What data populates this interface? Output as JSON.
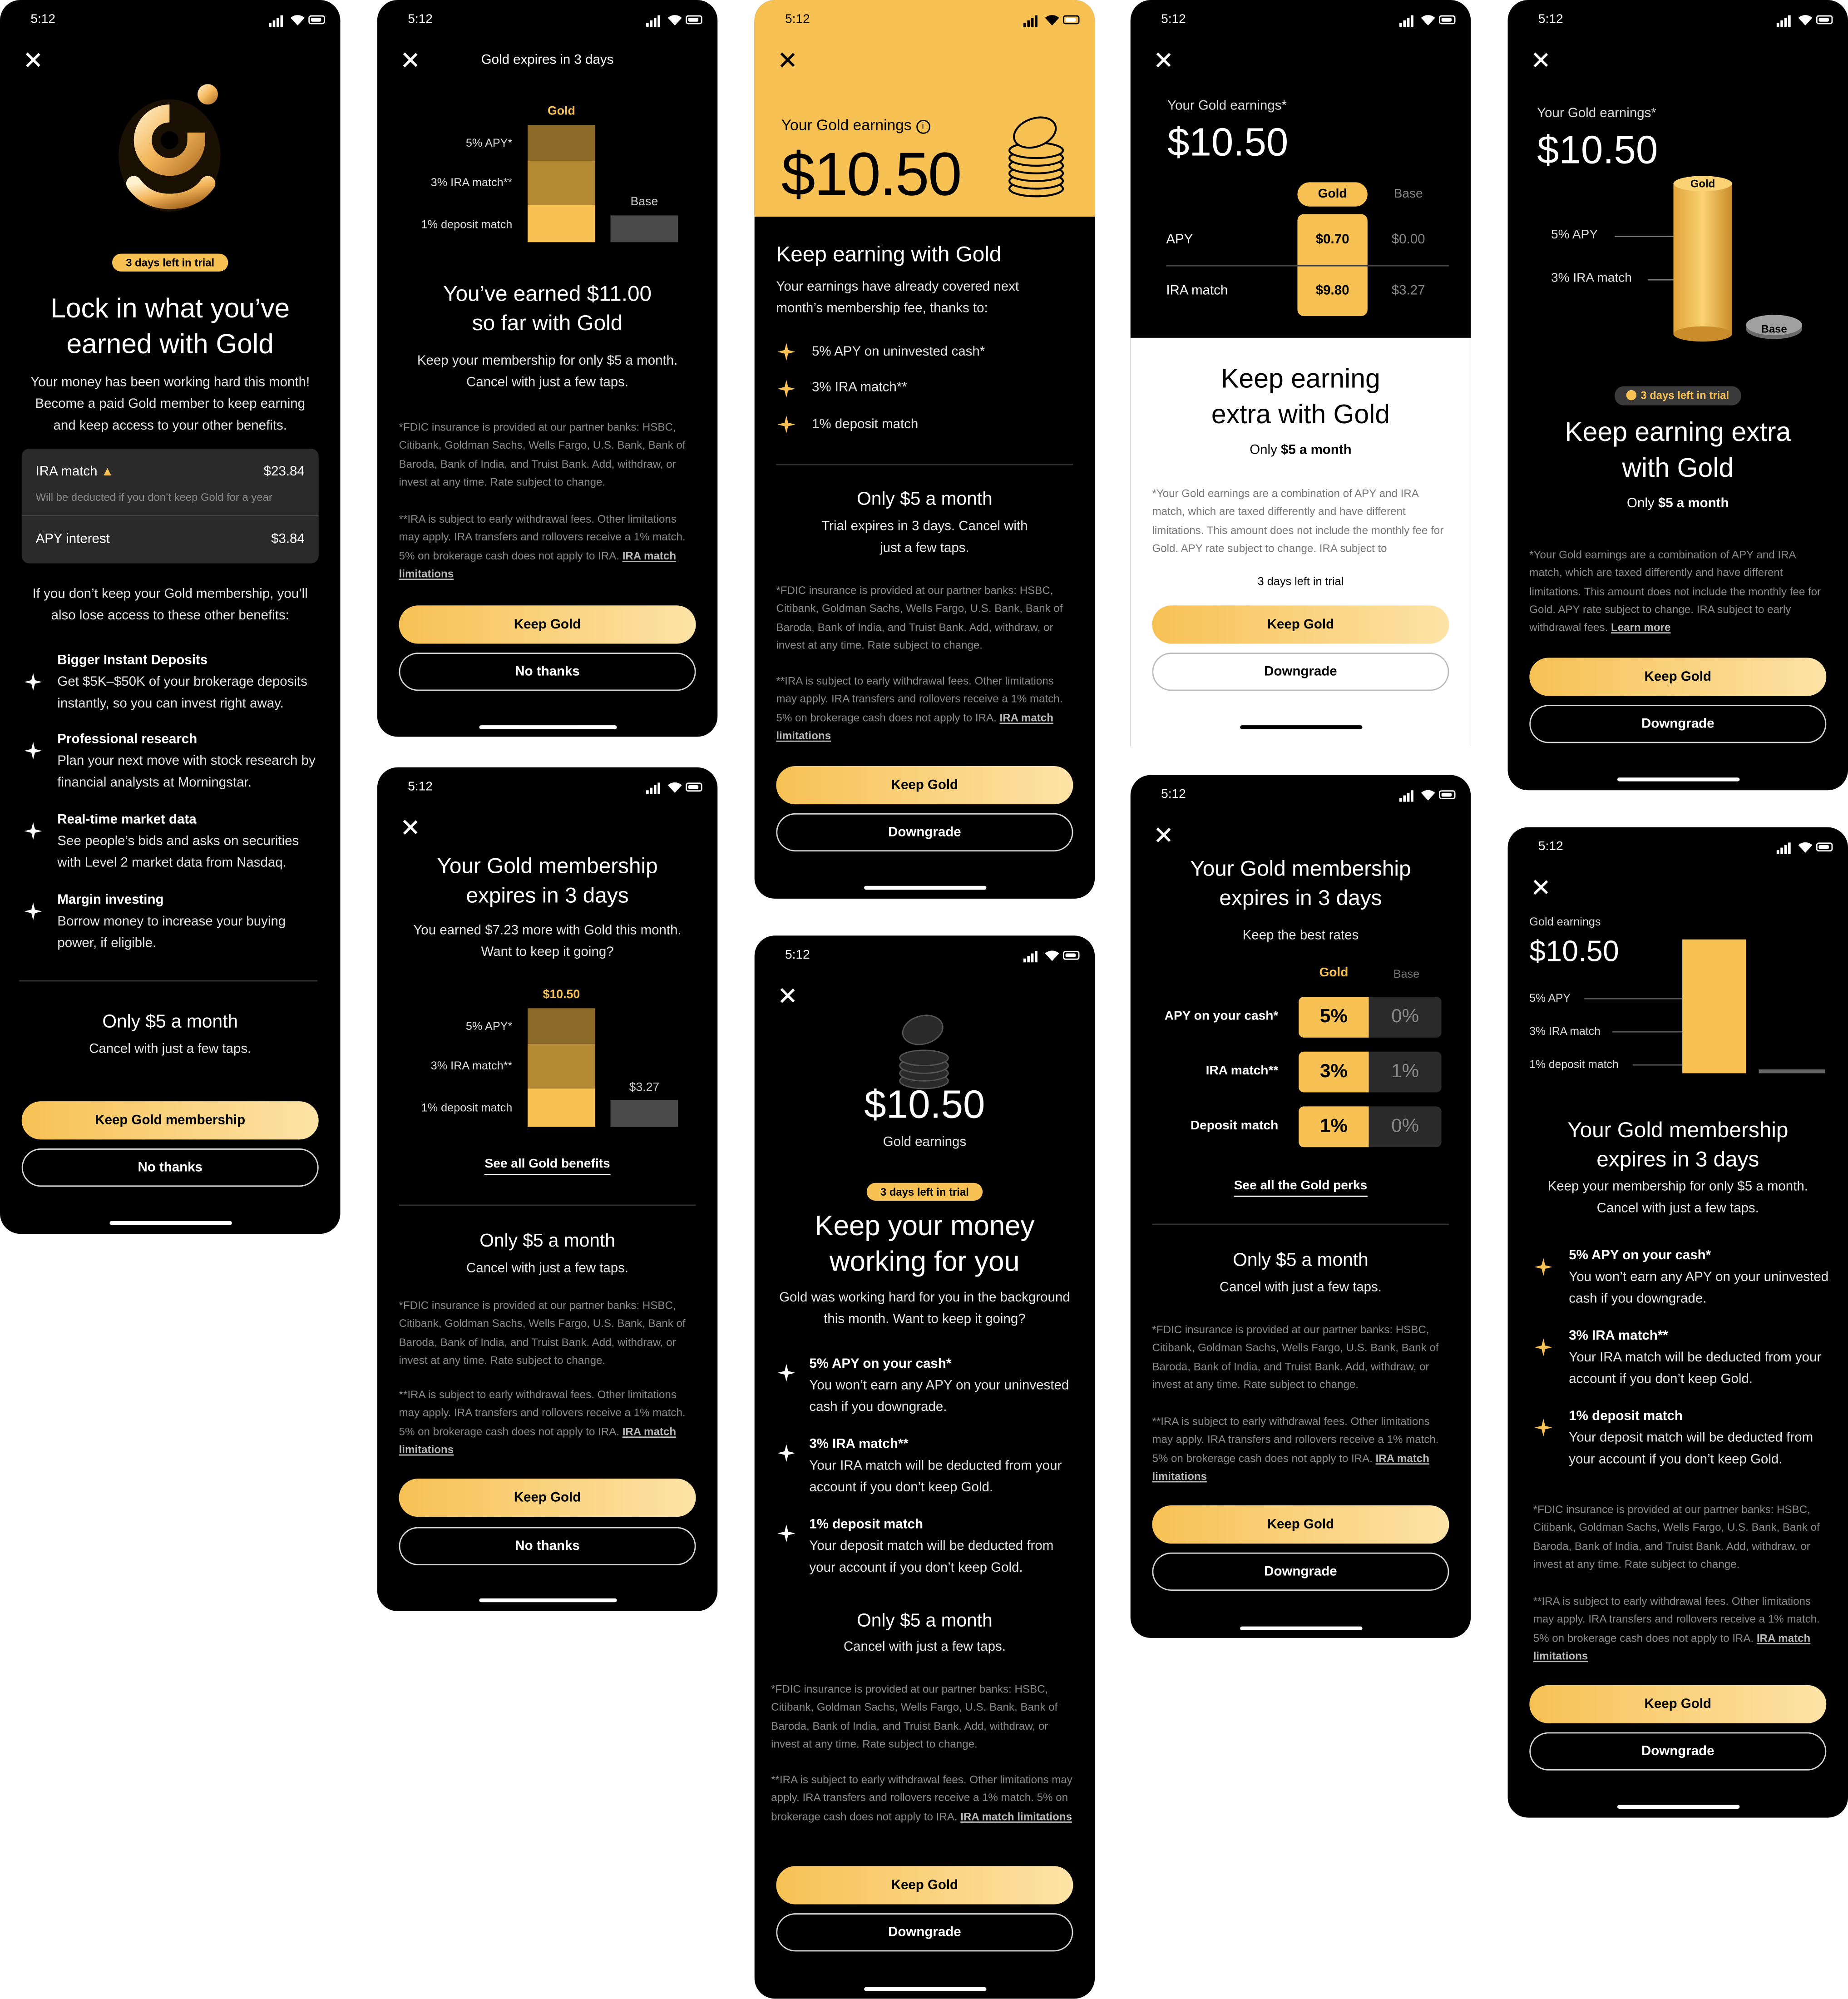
{
  "status": {
    "time": "5:12"
  },
  "s1": {
    "trial_pill": "3 days left in trial",
    "title": "Lock in what you’ve earned with Gold",
    "subtitle": "Your money has been working hard this month! Become a paid Gold member to keep earning and keep access to your other benefits.",
    "ira_label": "IRA match",
    "ira_value": "$23.84",
    "ira_note": "Will be deducted if you don’t keep Gold for a year",
    "apy_label": "APY interest",
    "apy_value": "$3.84",
    "lose_text": "If you don’t keep your Gold membership, you’ll also lose access to these other benefits:",
    "benefits": [
      {
        "title": "Bigger Instant Deposits",
        "desc": "Get $5K–$50K of your brokerage deposits instantly, so you can invest right away."
      },
      {
        "title": "Professional research",
        "desc": "Plan your next move with stock research by financial analysts at Morningstar."
      },
      {
        "title": "Real-time market data",
        "desc": "See people’s bids and asks on securities with Level 2 market data from Nasdaq."
      },
      {
        "title": "Margin investing",
        "desc": "Borrow money to increase your buying power, if eligible."
      }
    ],
    "price": "Only $5 a month",
    "price_sub": "Cancel with just a few taps.",
    "primary": "Keep Gold membership",
    "secondary": "No thanks"
  },
  "s2": {
    "header": "Gold expires in 3 days",
    "chart_gold_label": "Gold",
    "chart_base_label": "Base",
    "chart_rows": [
      "5% APY*",
      "3% IRA match**",
      "1% deposit match"
    ],
    "title": "You’ve earned $11.00 so far with Gold",
    "subtitle": "Keep your membership for only $5 a month. Cancel with just a few taps.",
    "fdic": "*FDIC insurance is provided at our partner banks: HSBC, Citibank, Goldman Sachs, Wells Fargo, U.S. Bank, Bank of Baroda, Bank of India, and Truist Bank. Add, withdraw, or invest at any time. Rate subject to change.",
    "ira_note": "**IRA is subject to early withdrawal fees. Other limitations may apply. IRA transfers and rollovers receive a 1% match. 5% on brokerage cash does not apply to IRA.",
    "ira_link": "IRA match limitations",
    "primary": "Keep Gold",
    "secondary": "No thanks"
  },
  "s3": {
    "title": "Your Gold membership expires in 3 days",
    "subtitle": "You earned $7.23 more with Gold this month. Want to keep it going?",
    "gold_total": "$10.50",
    "base_total": "$3.27",
    "chart_rows": [
      "5% APY*",
      "3% IRA match**",
      "1% deposit match"
    ],
    "link": "See all Gold benefits",
    "price": "Only $5 a month",
    "price_sub": "Cancel with just a few taps.",
    "fdic": "*FDIC insurance is provided at our partner banks: HSBC, Citibank, Goldman Sachs, Wells Fargo, U.S. Bank, Bank of Baroda, Bank of India, and Truist Bank. Add, withdraw, or invest at any time. Rate subject to change.",
    "ira_note": "**IRA is subject to early withdrawal fees. Other limitations may apply. IRA transfers and rollovers receive a 1% match. 5% on brokerage cash does not apply to IRA.",
    "ira_link": "IRA match limitations",
    "primary": "Keep Gold",
    "secondary": "No thanks"
  },
  "s4": {
    "earnings_label": "Your Gold earnings",
    "earnings_value": "$10.50",
    "title": "Keep earning with Gold",
    "subtitle": "Your earnings have already covered next month’s membership fee, thanks to:",
    "bullets": [
      "5% APY on uninvested cash*",
      "3% IRA match**",
      "1% deposit match"
    ],
    "price": "Only $5 a month",
    "price_sub": "Trial expires in 3 days. Cancel with just a few taps.",
    "fdic": "*FDIC insurance is provided at our partner banks: HSBC, Citibank, Goldman Sachs, Wells Fargo, U.S. Bank, Bank of Baroda, Bank of India, and Truist Bank. Add, withdraw, or invest at any time. Rate subject to change.",
    "ira_note": "**IRA is subject to early withdrawal fees. Other limitations may apply. IRA transfers and rollovers receive a 1% match. 5% on brokerage cash does not apply to IRA.",
    "ira_link": "IRA match limitations",
    "primary": "Keep Gold",
    "secondary": "Downgrade"
  },
  "s5": {
    "amount": "$10.50",
    "amount_label": "Gold earnings",
    "trial_pill": "3 days left in trial",
    "title": "Keep your money working for you",
    "subtitle": "Gold was working hard for you in the background this month. Want to keep it going?",
    "benefits": [
      {
        "title": "5% APY on your cash*",
        "desc": "You won’t earn any APY on your uninvested cash if you downgrade."
      },
      {
        "title": "3% IRA match**",
        "desc": "Your IRA match will be deducted from your account if you don’t keep Gold."
      },
      {
        "title": "1% deposit match",
        "desc": "Your deposit match will be deducted from your account if you don’t keep Gold."
      }
    ],
    "price": "Only $5 a month",
    "price_sub": "Cancel with just a few taps.",
    "fdic": "*FDIC insurance is provided at our partner banks: HSBC, Citibank, Goldman Sachs, Wells Fargo, U.S. Bank, Bank of Baroda, Bank of India, and Truist Bank. Add, withdraw, or invest at any time. Rate subject to change.",
    "ira_note": "**IRA is subject to early withdrawal fees. Other limitations may apply. IRA transfers and rollovers receive a 1% match. 5% on brokerage cash does not apply to IRA.",
    "ira_link": "IRA match limitations",
    "primary": "Keep Gold",
    "secondary": "Downgrade"
  },
  "s6": {
    "earnings_label": "Your Gold earnings*",
    "earnings_value": "$10.50",
    "col_gold": "Gold",
    "col_base": "Base",
    "rows": [
      {
        "label": "APY",
        "gold": "$0.70",
        "base": "$0.00"
      },
      {
        "label": "IRA match",
        "gold": "$9.80",
        "base": "$3.27"
      }
    ],
    "title": "Keep earning extra with Gold",
    "subtitle_pre": "Only",
    "subtitle_bold": "$5 a month",
    "note": "*Your Gold earnings are a combination of APY and IRA match, which are taxed differently and have different limitations. This amount does not include the monthly fee for Gold. APY rate subject to change. IRA subject to",
    "trial": "3 days left in trial",
    "primary": "Keep Gold",
    "secondary": "Downgrade"
  },
  "s7": {
    "title": "Your Gold membership expires in 3 days",
    "subtitle": "Keep the best rates",
    "col_gold": "Gold",
    "col_base": "Base",
    "rows": [
      {
        "label": "APY  on your cash*",
        "gold": "5%",
        "base": "0%"
      },
      {
        "label": "IRA match**",
        "gold": "3%",
        "base": "1%"
      },
      {
        "label": "Deposit match",
        "gold": "1%",
        "base": "0%"
      }
    ],
    "link": "See all the Gold perks",
    "price": "Only $5 a month",
    "price_sub": "Cancel with just a few taps.",
    "fdic": "*FDIC insurance is provided at our partner banks: HSBC, Citibank, Goldman Sachs, Wells Fargo, U.S. Bank, Bank of Baroda, Bank of India, and Truist Bank. Add, withdraw, or invest at any time. Rate subject to change.",
    "ira_note": "**IRA is subject to early withdrawal fees. Other limitations may apply. IRA transfers and rollovers receive a 1% match. 5% on brokerage cash does not apply to IRA.",
    "ira_link": "IRA match limitations",
    "primary": "Keep Gold",
    "secondary": "Downgrade"
  },
  "s8": {
    "earnings_label": "Your Gold earnings*",
    "earnings_value": "$10.50",
    "cyl_gold": "Gold",
    "cyl_base": "Base",
    "rows": [
      "5% APY",
      "3% IRA match"
    ],
    "trial_pill": "3 days left in trial",
    "title": "Keep earning extra with Gold",
    "subtitle_pre": "Only",
    "subtitle_bold": "$5 a month",
    "note": "*Your Gold earnings are a combination of APY and IRA match, which are taxed differently and have different limitations. This amount does not include the monthly fee for Gold. APY rate subject to change. IRA subject to early withdrawal fees.",
    "note_link": "Learn more",
    "primary": "Keep Gold",
    "secondary": "Downgrade"
  },
  "s9": {
    "earnings_label": "Gold earnings",
    "earnings_value": "$10.50",
    "rows": [
      "5% APY",
      "3% IRA match",
      "1% deposit match"
    ],
    "title": "Your Gold membership expires in 3 days",
    "subtitle": "Keep your membership for only $5 a month. Cancel with just a few taps.",
    "benefits": [
      {
        "title": "5% APY on your cash*",
        "desc": "You won’t earn any APY on your uninvested cash if you downgrade."
      },
      {
        "title": "3% IRA match**",
        "desc": "Your IRA match will be deducted from your account if you don’t keep Gold."
      },
      {
        "title": "1% deposit match",
        "desc": "Your deposit match will be deducted from your account if you don’t keep Gold."
      }
    ],
    "fdic": "*FDIC insurance is provided at our partner banks: HSBC, Citibank, Goldman Sachs, Wells Fargo, U.S. Bank, Bank of Baroda, Bank of India, and Truist Bank. Add, withdraw, or invest at any time. Rate subject to change.",
    "ira_note": "**IRA is subject to early withdrawal fees. Other limitations may apply. IRA transfers and rollovers receive a 1% match. 5% on brokerage cash does not apply to IRA.",
    "ira_link": "IRA match limitations",
    "primary": "Keep Gold",
    "secondary": "Downgrade"
  },
  "colors": {
    "gold": "#f7c154",
    "gold_dark": "#b58a34",
    "gold_darker": "#8c6a28",
    "base_gray": "#4a4a4a",
    "background": "#000000"
  }
}
